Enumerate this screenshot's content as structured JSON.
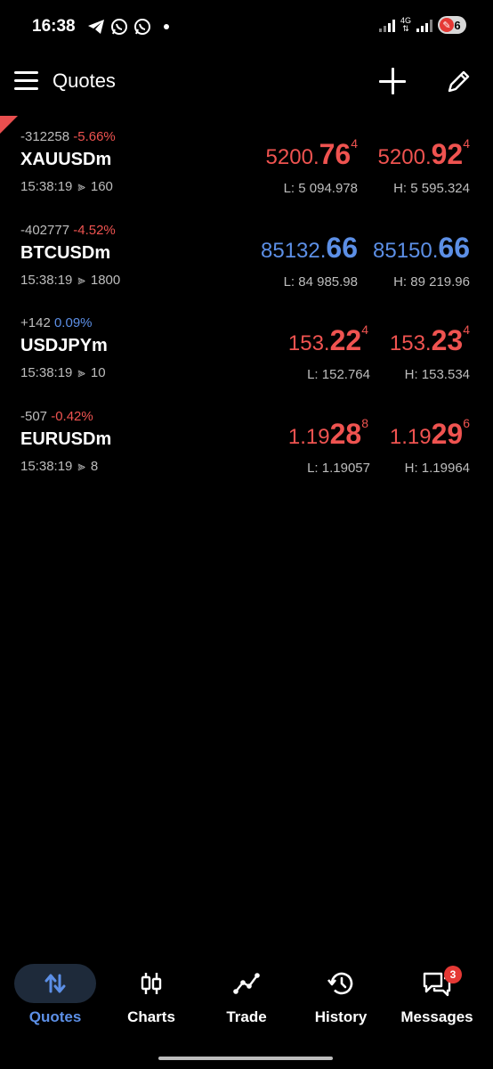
{
  "status": {
    "time": "16:38",
    "net_label": "4G",
    "battery": "6"
  },
  "appbar": {
    "title": "Quotes"
  },
  "quotes": [
    {
      "change_points": "-312258",
      "change_pct": "-5.66%",
      "pct_color": "red",
      "symbol": "XAUUSDm",
      "time": "15:38:19",
      "spread": "160",
      "bid": {
        "base": "5200.",
        "big": "76",
        "sup": "4",
        "color": "red"
      },
      "ask": {
        "base": "5200.",
        "big": "92",
        "sup": "4",
        "color": "red"
      },
      "low": "L: 5 094.978",
      "high": "H: 5 595.324"
    },
    {
      "change_points": "-402777",
      "change_pct": "-4.52%",
      "pct_color": "red",
      "symbol": "BTCUSDm",
      "time": "15:38:19",
      "spread": "1800",
      "bid": {
        "base": "85132.",
        "big": "66",
        "sup": "",
        "color": "blue"
      },
      "ask": {
        "base": "85150.",
        "big": "66",
        "sup": "",
        "color": "blue"
      },
      "low": "L: 84 985.98",
      "high": "H: 89 219.96"
    },
    {
      "change_points": "+142",
      "change_pct": "0.09%",
      "pct_color": "blue",
      "symbol": "USDJPYm",
      "time": "15:38:19",
      "spread": "10",
      "bid": {
        "base": "153.",
        "big": "22",
        "sup": "4",
        "color": "red"
      },
      "ask": {
        "base": "153.",
        "big": "23",
        "sup": "4",
        "color": "red"
      },
      "low": "L: 152.764",
      "high": "H: 153.534"
    },
    {
      "change_points": "-507",
      "change_pct": "-0.42%",
      "pct_color": "red",
      "symbol": "EURUSDm",
      "time": "15:38:19",
      "spread": "8",
      "bid": {
        "base": "1.19",
        "big": "28",
        "sup": "8",
        "color": "red"
      },
      "ask": {
        "base": "1.19",
        "big": "29",
        "sup": "6",
        "color": "red"
      },
      "low": "L: 1.19057",
      "high": "H: 1.19964"
    }
  ],
  "nav": {
    "quotes": "Quotes",
    "charts": "Charts",
    "trade": "Trade",
    "history": "History",
    "messages": "Messages",
    "messages_badge": "3"
  },
  "colors": {
    "red": "#ef5350",
    "blue": "#5c8fe6",
    "background": "#000000"
  }
}
